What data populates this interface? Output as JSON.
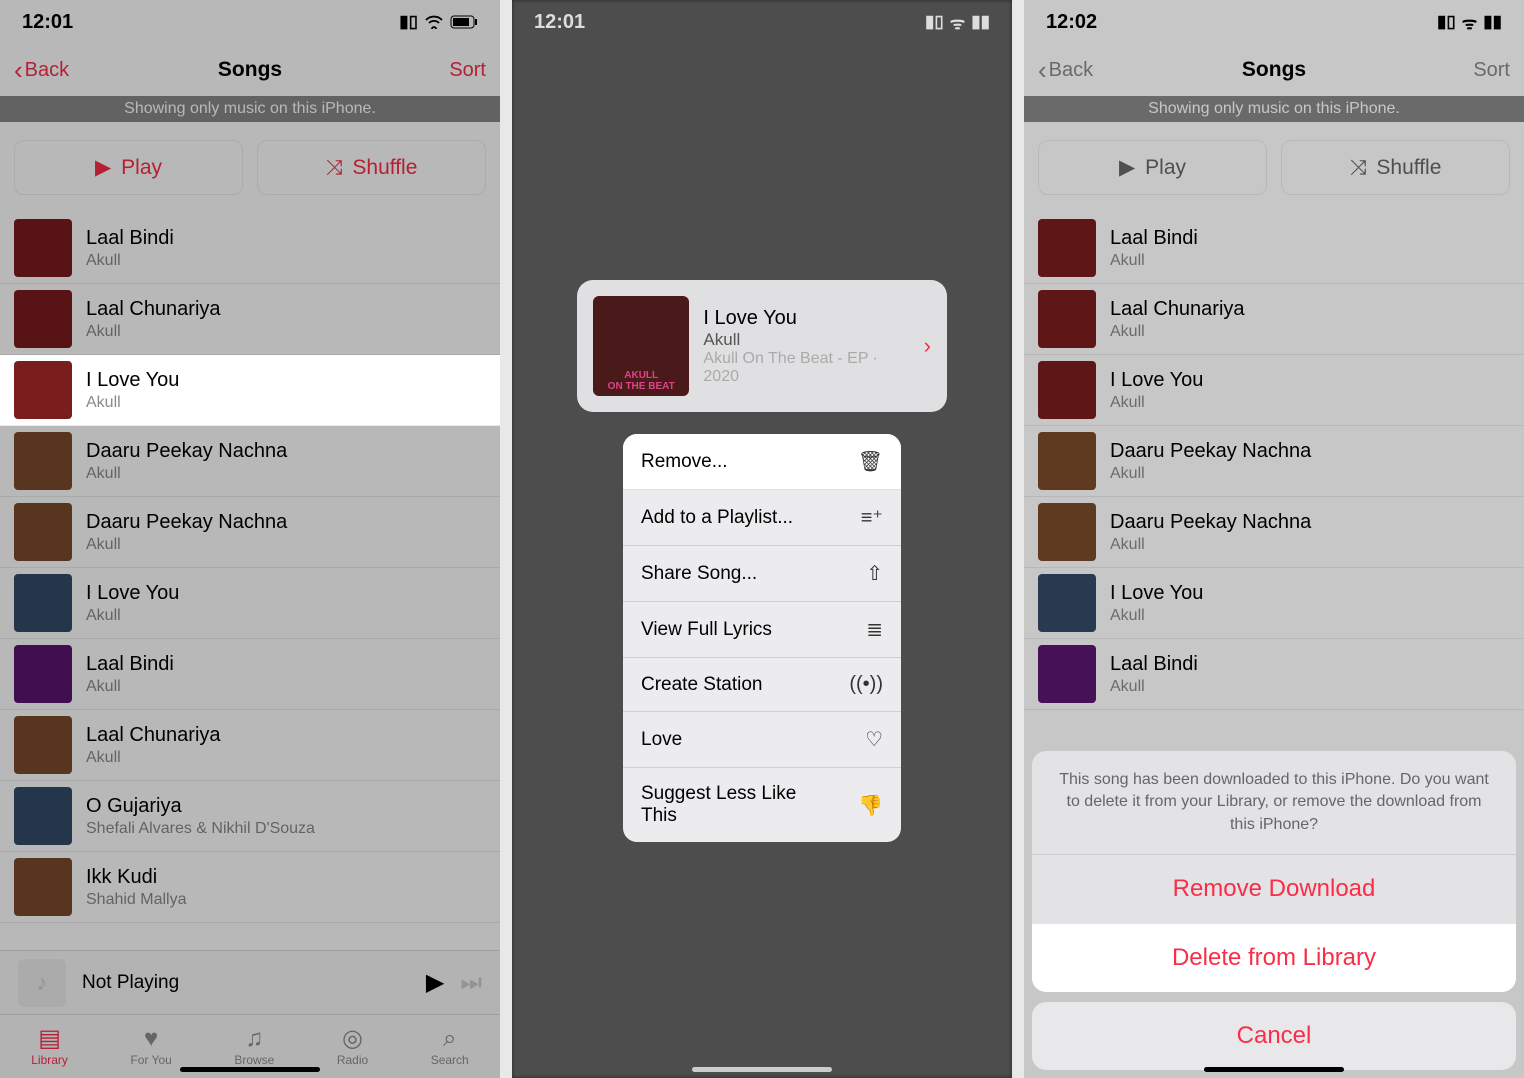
{
  "status": {
    "time1": "12:01",
    "time2": "12:01",
    "time3": "12:02"
  },
  "nav": {
    "back": "Back",
    "title": "Songs",
    "sort": "Sort"
  },
  "banner": "Showing only music on this iPhone.",
  "actions": {
    "play": "Play",
    "shuffle": "Shuffle"
  },
  "songs": [
    {
      "title": "Laal Bindi",
      "artist": "Akull"
    },
    {
      "title": "Laal Chunariya",
      "artist": "Akull"
    },
    {
      "title": "I Love You",
      "artist": "Akull"
    },
    {
      "title": "Daaru Peekay Nachna",
      "artist": "Akull"
    },
    {
      "title": "Daaru Peekay Nachna",
      "artist": "Akull"
    },
    {
      "title": "I Love You",
      "artist": "Akull"
    },
    {
      "title": "Laal Bindi",
      "artist": "Akull"
    },
    {
      "title": "Laal Chunariya",
      "artist": "Akull"
    },
    {
      "title": "O Gujariya",
      "artist": "Shefali Alvares & Nikhil D'Souza"
    },
    {
      "title": "Ikk Kudi",
      "artist": "Shahid Mallya"
    }
  ],
  "now_playing": "Not Playing",
  "tabs": {
    "library": "Library",
    "foryou": "For You",
    "browse": "Browse",
    "radio": "Radio",
    "search": "Search"
  },
  "context": {
    "song_title": "I Love You",
    "song_artist": "Akull",
    "song_album": "Akull On The Beat - EP · 2020",
    "menu": {
      "remove": "Remove...",
      "add_playlist": "Add to a Playlist...",
      "share": "Share Song...",
      "lyrics": "View Full Lyrics",
      "station": "Create Station",
      "love": "Love",
      "suggest_less": "Suggest Less Like This"
    }
  },
  "sheet": {
    "message": "This song has been downloaded to this iPhone. Do you want to delete it from your Library, or remove the download from this iPhone?",
    "remove_download": "Remove Download",
    "delete_library": "Delete from Library",
    "cancel": "Cancel"
  }
}
